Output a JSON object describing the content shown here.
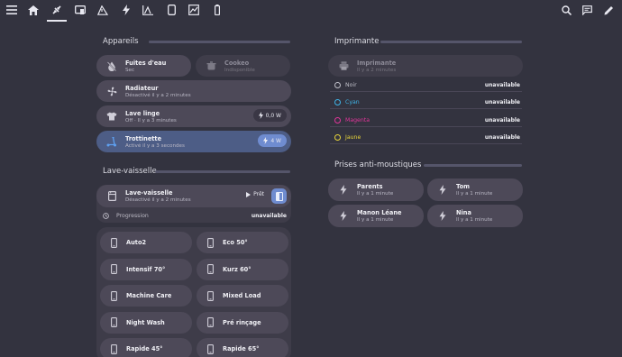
{
  "toolbar": {
    "left_icons": [
      "menu-icon",
      "home-icon",
      "plug-icon",
      "devices-icon",
      "alert-icon",
      "bolt-icon",
      "chart-icon",
      "tablet-icon",
      "graph-icon",
      "battery-icon"
    ],
    "right_icons": [
      "search-icon",
      "chat-icon",
      "edit-icon"
    ]
  },
  "appareils": {
    "title": "Appareils",
    "fuites": {
      "name": "Fuites d'eau",
      "state": "Sec"
    },
    "cookeo": {
      "name": "Cookeo",
      "state": "Indisponible"
    },
    "radiateur": {
      "name": "Radiateur",
      "state": "Désactivé il y a 2 minutes"
    },
    "lave_linge": {
      "name": "Lave linge",
      "state": "Off · Il y a 3 minutes",
      "power": "0,0 W"
    },
    "trottinette": {
      "name": "Trottinette",
      "state": "Activé il y a 3 secondes",
      "power": "4 W"
    }
  },
  "lave_vaisselle": {
    "title": "Lave-vaisselle",
    "card": {
      "name": "Lave-vaisselle",
      "state": "Désactivé il y a 2 minutes",
      "status": "Prêt"
    },
    "progression": {
      "label": "Progression",
      "value": "unavailable"
    },
    "programs": [
      "Auto2",
      "Eco 50°",
      "Intensif 70°",
      "Kurz 60°",
      "Machine Care",
      "Mixed Load",
      "Night Wash",
      "Pré rinçage",
      "Rapide 45°",
      "Rapide 65°"
    ]
  },
  "imprimante": {
    "title": "Imprimante",
    "card": {
      "name": "Imprimante",
      "state": "Il y a 2 minutes"
    },
    "inks": [
      {
        "label": "Noir",
        "value": "unavailable",
        "color": "#bfbfc8"
      },
      {
        "label": "Cyan",
        "value": "unavailable",
        "color": "#3fb5e8"
      },
      {
        "label": "Magenta",
        "value": "unavailable",
        "color": "#e0359a"
      },
      {
        "label": "Jaune",
        "value": "unavailable",
        "color": "#e8d53a"
      }
    ]
  },
  "prises": {
    "title": "Prises anti-moustiques",
    "items": [
      {
        "name": "Parents",
        "state": "Il y a 1 minute"
      },
      {
        "name": "Tom",
        "state": "Il y a 1 minute"
      },
      {
        "name": "Manon Léane",
        "state": "Il y a 1 minute"
      },
      {
        "name": "Nina",
        "state": "Il y a 1 minute"
      }
    ]
  },
  "colors": {
    "background": "#33333f",
    "card": "#4d4958",
    "active_card": "#4d5d86",
    "accent": "#6f8cd0"
  }
}
